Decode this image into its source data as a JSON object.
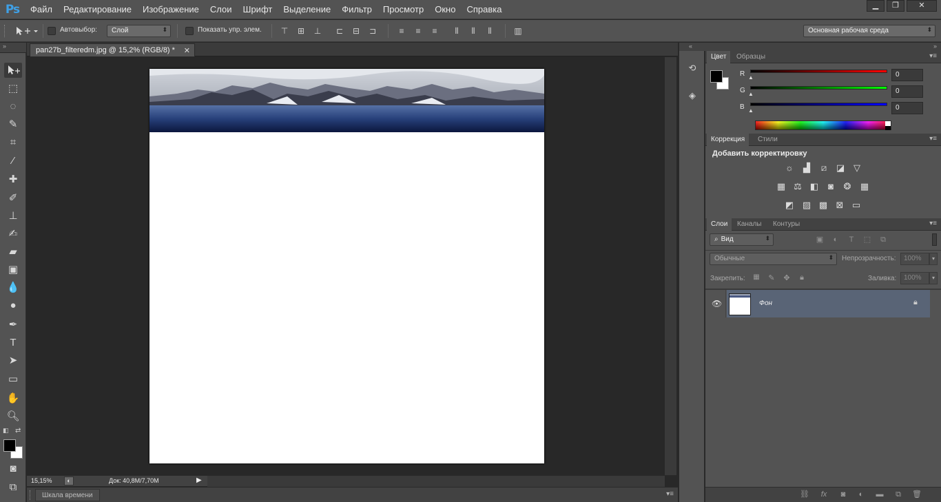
{
  "app": {
    "logo": "Ps"
  },
  "menu": [
    "Файл",
    "Редактирование",
    "Изображение",
    "Слои",
    "Шрифт",
    "Выделение",
    "Фильтр",
    "Просмотр",
    "Окно",
    "Справка"
  ],
  "window_controls": {
    "minimize": "▁",
    "restore": "❐",
    "close": "✕"
  },
  "options": {
    "autoselect_label": "Автовыбор:",
    "autoselect_value": "Слой",
    "show_transform_label": "Показать упр. элем.",
    "workspace_value": "Основная рабочая среда"
  },
  "document": {
    "tab_title": "pan27b_filteredm.jpg @ 15,2% (RGB/8) *",
    "tab_close": "✕"
  },
  "status": {
    "zoom": "15,15%",
    "doc_info": "Док: 40,8M/7,70M"
  },
  "timeline": {
    "label": "Шкала времени"
  },
  "color_panel": {
    "tabs": [
      "Цвет",
      "Образцы"
    ],
    "channels": [
      {
        "label": "R",
        "value": "0"
      },
      {
        "label": "G",
        "value": "0"
      },
      {
        "label": "B",
        "value": "0"
      }
    ],
    "foreground": "#000000",
    "background": "#ffffff"
  },
  "adjustments_panel": {
    "tabs": [
      "Коррекция",
      "Стили"
    ],
    "heading": "Добавить корректировку"
  },
  "layers_panel": {
    "tabs": [
      "Слои",
      "Каналы",
      "Контуры"
    ],
    "filter_value": "Вид",
    "blend_mode": "Обычные",
    "opacity_label": "Непрозрачность:",
    "opacity_value": "100%",
    "lock_label": "Закрепить:",
    "fill_label": "Заливка:",
    "fill_value": "100%",
    "layers": [
      {
        "name": "Фон",
        "locked": true,
        "visible": true
      }
    ]
  }
}
